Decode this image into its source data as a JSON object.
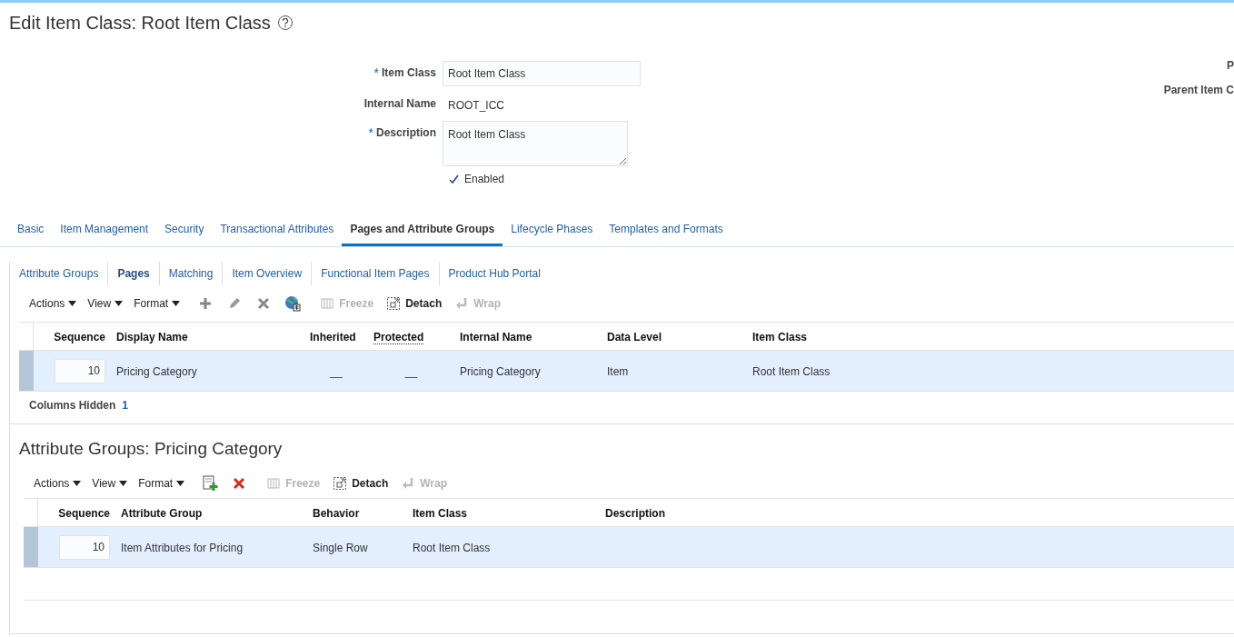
{
  "title": "Edit Item Class: Root Item Class",
  "form": {
    "fields": [
      {
        "kind": "input",
        "required_mark": "*",
        "label": "Item Class",
        "value": "Root Item Class"
      },
      {
        "kind": "text",
        "label": "Internal Name",
        "value": "ROOT_ICC"
      },
      {
        "kind": "textarea",
        "required_mark": "*",
        "label": "Description",
        "value": "Root Item Class"
      }
    ],
    "enabled": {
      "label": "Enabled",
      "checked": true
    },
    "right_labels": [
      "P",
      "Parent Item C"
    ]
  },
  "tabs": [
    {
      "label": "Basic",
      "selected": false
    },
    {
      "label": "Item Management",
      "selected": false
    },
    {
      "label": "Security",
      "selected": false
    },
    {
      "label": "Transactional Attributes",
      "selected": false
    },
    {
      "label": "Pages and Attribute Groups",
      "selected": true
    },
    {
      "label": "Lifecycle Phases",
      "selected": false
    },
    {
      "label": "Templates and Formats",
      "selected": false
    }
  ],
  "subtabs": [
    {
      "label": "Attribute Groups",
      "selected": false
    },
    {
      "label": "Pages",
      "selected": true
    },
    {
      "label": "Matching",
      "selected": false
    },
    {
      "label": "Item Overview",
      "selected": false
    },
    {
      "label": "Functional Item Pages",
      "selected": false
    },
    {
      "label": "Product Hub Portal",
      "selected": false
    }
  ],
  "pages_toolbar": [
    {
      "kind": "menu",
      "label": "Actions"
    },
    {
      "kind": "menu",
      "label": "View"
    },
    {
      "kind": "menu",
      "label": "Format"
    },
    {
      "kind": "icon"
    },
    {
      "kind": "icon"
    },
    {
      "kind": "icon"
    },
    {
      "kind": "icon"
    },
    {
      "kind": "button",
      "label": "Freeze",
      "disabled": true
    },
    {
      "kind": "button",
      "label": "Detach",
      "disabled": false
    },
    {
      "kind": "button",
      "label": "Wrap",
      "disabled": true
    }
  ],
  "pages_table": {
    "columns": [
      {
        "label": "Sequence",
        "underlined": false
      },
      {
        "label": "Display Name",
        "underlined": false
      },
      {
        "label": "Inherited",
        "underlined": false
      },
      {
        "label": "Protected",
        "underlined": true
      },
      {
        "label": "Internal Name",
        "underlined": false
      },
      {
        "label": "Data Level",
        "underlined": false
      },
      {
        "label": "Item Class",
        "underlined": false
      }
    ],
    "rows": [
      {
        "selected": true,
        "sequence": "10",
        "display_name": "Pricing Category",
        "inherited": "__",
        "protected": "__",
        "internal_name": "Pricing Category",
        "data_level": "Item",
        "item_class": "Root Item Class"
      }
    ]
  },
  "columns_hidden": {
    "label": "Columns Hidden",
    "count": "1"
  },
  "attribute_groups": {
    "heading": "Attribute Groups: Pricing Category",
    "toolbar": [
      {
        "kind": "menu",
        "label": "Actions"
      },
      {
        "kind": "menu",
        "label": "View"
      },
      {
        "kind": "menu",
        "label": "Format"
      },
      {
        "kind": "icon"
      },
      {
        "kind": "icon"
      },
      {
        "kind": "button",
        "label": "Freeze",
        "disabled": true
      },
      {
        "kind": "button",
        "label": "Detach",
        "disabled": false
      },
      {
        "kind": "button",
        "label": "Wrap",
        "disabled": true
      }
    ],
    "table": {
      "columns": [
        {
          "label": "Sequence",
          "underlined": false
        },
        {
          "label": "Attribute Group",
          "underlined": false
        },
        {
          "label": "Behavior",
          "underlined": false
        },
        {
          "label": "Item Class",
          "underlined": false
        },
        {
          "label": "Description",
          "underlined": false
        }
      ],
      "rows": [
        {
          "selected": true,
          "sequence": "10",
          "attribute_group": "Item Attributes for Pricing",
          "behavior": "Single Row",
          "item_class": "Root Item Class"
        }
      ]
    }
  }
}
